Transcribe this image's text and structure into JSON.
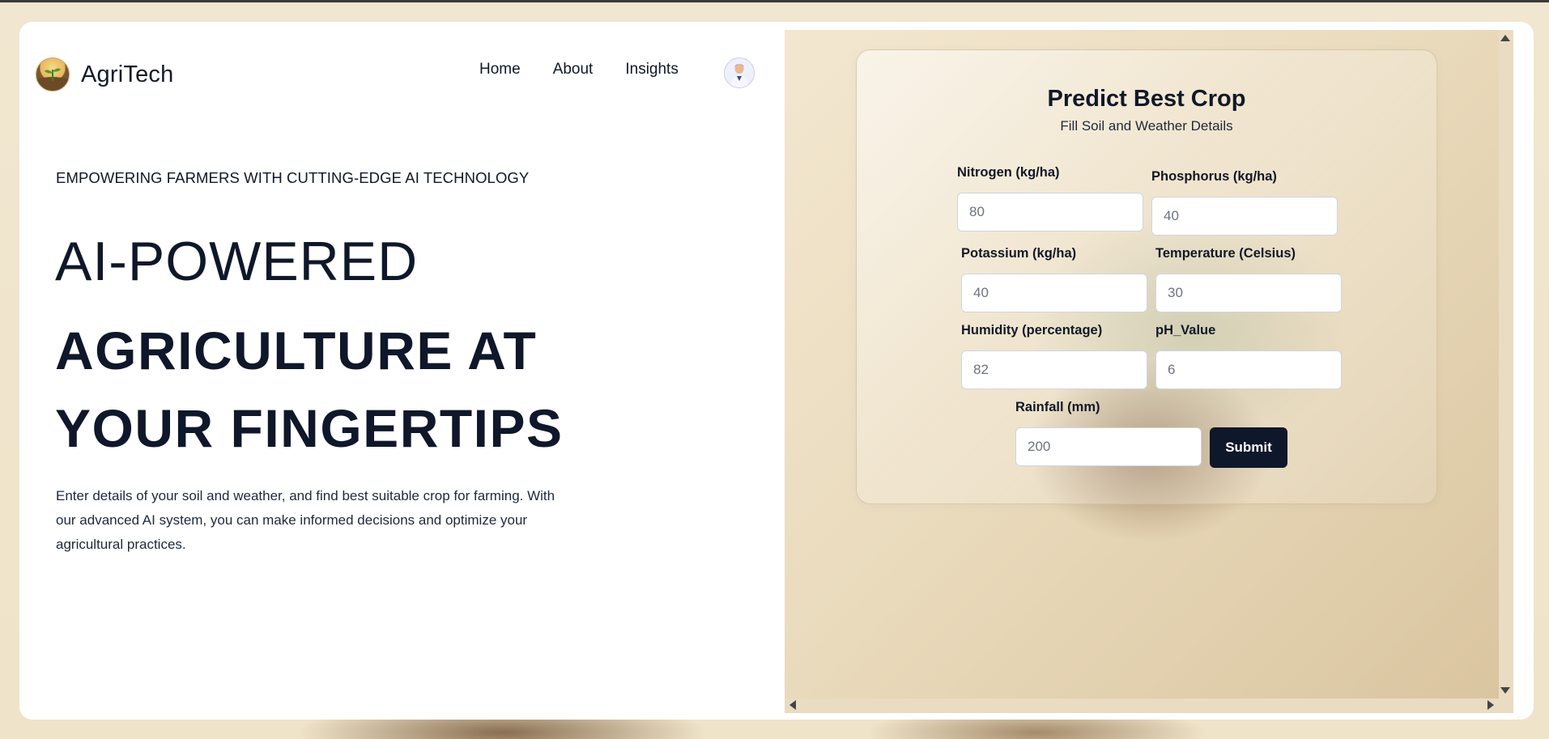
{
  "header": {
    "brand": "AgriTech",
    "nav": [
      "Home",
      "About",
      "Insights"
    ]
  },
  "hero": {
    "eyebrow": "EMPOWERING FARMERS WITH CUTTING-EDGE AI TECHNOLOGY",
    "title_light": "AI-POWERED",
    "title_bold": "AGRICULTURE AT YOUR FINGERTIPS",
    "description": "Enter details of your soil and weather, and find best suitable crop for farming. With our advanced AI system, you can make informed decisions and optimize your agricultural practices."
  },
  "form": {
    "title": "Predict Best Crop",
    "subtitle": "Fill Soil and Weather Details",
    "fields": [
      {
        "label": "Nitrogen (kg/ha)",
        "placeholder": "80"
      },
      {
        "label": "Phosphorus (kg/ha)",
        "placeholder": "40"
      },
      {
        "label": "Potassium (kg/ha)",
        "placeholder": "40"
      },
      {
        "label": "Temperature (Celsius)",
        "placeholder": "30"
      },
      {
        "label": "Humidity (percentage)",
        "placeholder": "82"
      },
      {
        "label": "pH_Value",
        "placeholder": "6"
      },
      {
        "label": "Rainfall (mm)",
        "placeholder": "200"
      }
    ],
    "submit": "Submit"
  }
}
